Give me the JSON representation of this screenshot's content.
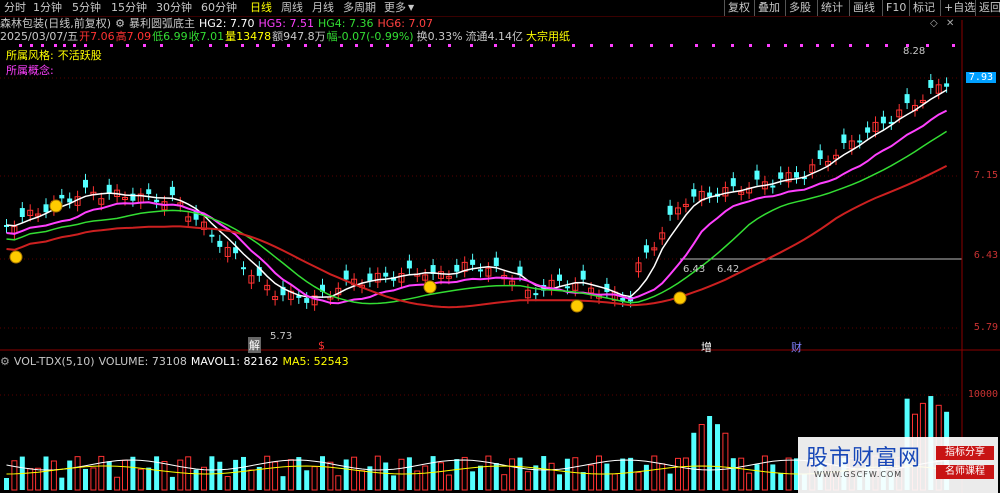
{
  "toolbar": {
    "tabs": [
      "分时",
      "1分钟",
      "5分钟",
      "15分钟",
      "30分钟",
      "60分钟",
      "日线",
      "周线",
      "月线",
      "多周期",
      "更多"
    ],
    "active": "日线",
    "right_buttons": [
      "复权",
      "叠加",
      "多股",
      "统计",
      "画线",
      "F10",
      "标记",
      "+自选",
      "返回"
    ]
  },
  "header": {
    "stock": "森林包装(日线,前复权)",
    "indicator": "暴利圆弧底主",
    "hg2": "HG2: 7.70",
    "hg5": "HG5: 7.51",
    "hg4": "HG4: 7.36",
    "hg6": "HG6: 7.07"
  },
  "quote": {
    "date": "2025/03/07/五",
    "open": "开7.06",
    "high": "高7.09",
    "low": "低6.99",
    "close": "收7.01",
    "volume": "量13478",
    "amount": "额947.8万",
    "change": "幅-0.07(-0.99%)",
    "turnover": "换0.33%",
    "float": "流通4.14亿",
    "sector": "大宗用纸"
  },
  "side_labels": {
    "style_label": "所属风格:",
    "style_value": "不活跃股",
    "concept_label": "所属概念:"
  },
  "price_axis": [
    "7.93",
    "7.15",
    "6.43",
    "5.79"
  ],
  "annotations": {
    "high_label": "8.28",
    "low_label": "5.73",
    "mid_label": "6.42",
    "mid_label2": "6.43",
    "jie": "解",
    "zeng": "增",
    "cai": "财",
    "dollar": "$"
  },
  "volume_header": {
    "name": "VOL-TDX(5,10)",
    "volume": "VOLUME: 73108",
    "mavol1": "MAVOL1: 82162",
    "ma5": "MA5: 52543"
  },
  "volume_axis": [
    "10000",
    "5000"
  ],
  "watermark": {
    "title": "股市财富网",
    "url": "WWW.GSCFW.COM",
    "tag1": "指标分享",
    "tag2": "名师课程"
  },
  "colors": {
    "up": "#ff3232",
    "down": "#54ffff",
    "ma_white": "#ffffff",
    "ma_magenta": "#ff40ff",
    "ma_green": "#33dd33",
    "ma_red": "#cc2020"
  }
}
